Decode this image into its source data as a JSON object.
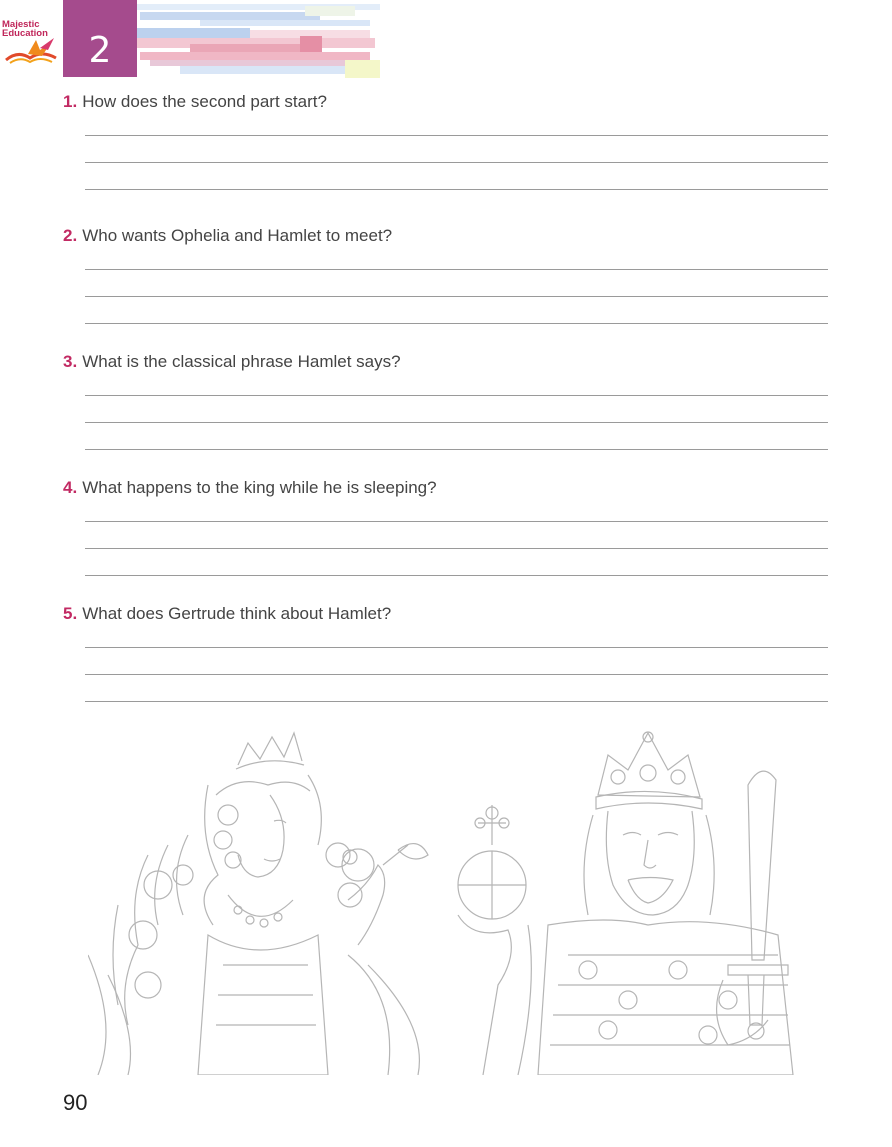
{
  "header": {
    "logo_text_line1": "Majestic",
    "logo_text_line2": "Education",
    "chapter_number": "2",
    "stripe_colors": [
      "#d9e6f7",
      "#bcd1ee",
      "#f3c7d2",
      "#eaa6b6",
      "#f7dde4",
      "#c7d8f0",
      "#f0b7c5",
      "#e3edf9"
    ]
  },
  "questions": [
    {
      "number": "1.",
      "text": "How does the second part start?"
    },
    {
      "number": "2.",
      "text": "Who wants Ophelia and Hamlet to meet?"
    },
    {
      "number": "3.",
      "text": "What is the classical phrase Hamlet says?"
    },
    {
      "number": "4.",
      "text": "What happens to the king while he is sleeping?"
    },
    {
      "number": "5.",
      "text": "What does Gertrude think about Hamlet?"
    }
  ],
  "illustration": {
    "left_figure": "queen-drawing",
    "right_figure": "king-drawing"
  },
  "footer": {
    "page_number": "90"
  },
  "colors": {
    "accent": "#c22a63",
    "chapter_tab": "#a54b8d",
    "rule": "#9a9a9a"
  }
}
